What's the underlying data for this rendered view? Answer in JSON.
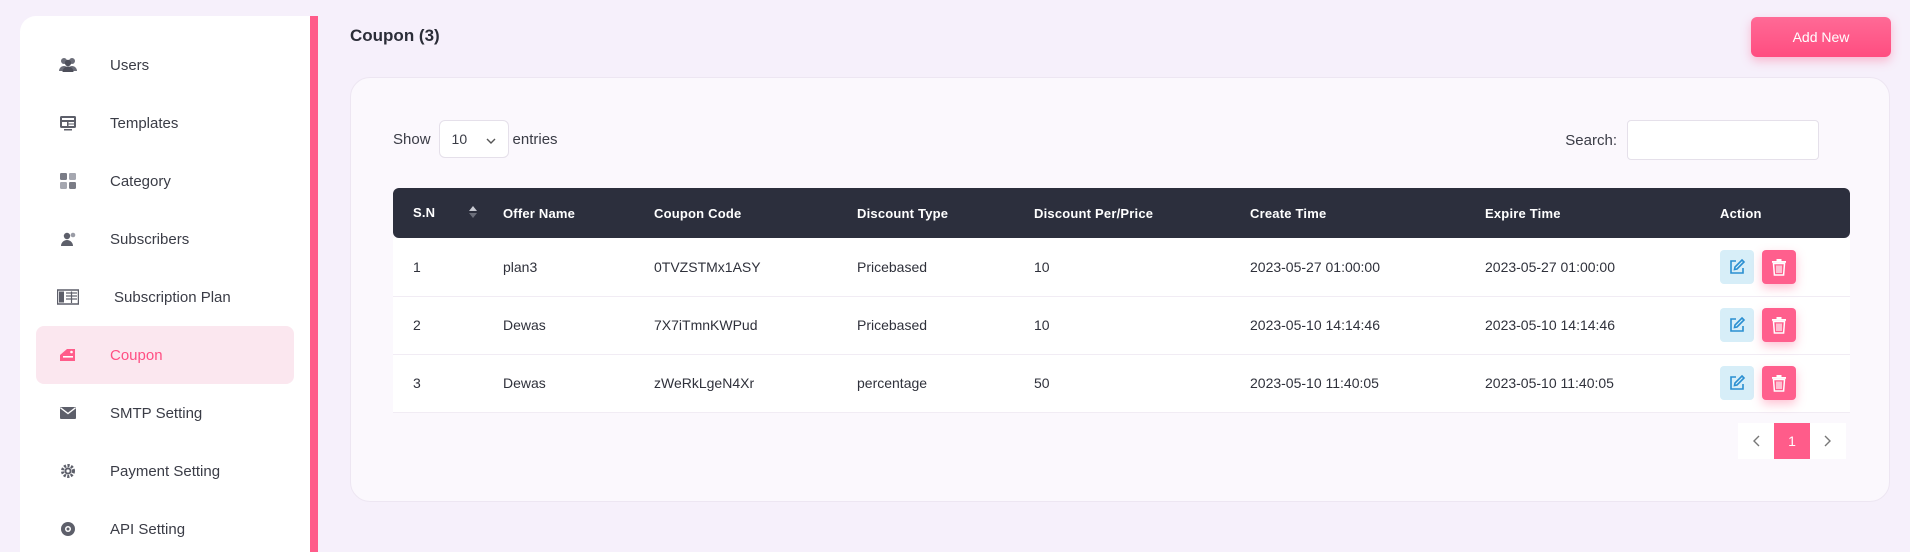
{
  "sidebar": {
    "items": [
      {
        "label": "Users",
        "icon": "users-icon",
        "active": false
      },
      {
        "label": "Templates",
        "icon": "templates-icon",
        "active": false
      },
      {
        "label": "Category",
        "icon": "grid-icon",
        "active": false
      },
      {
        "label": "Subscribers",
        "icon": "user-bell-icon",
        "active": false
      },
      {
        "label": "Subscription Plan",
        "icon": "plan-table-icon",
        "active": false
      },
      {
        "label": "Coupon",
        "icon": "coupon-icon",
        "active": true
      },
      {
        "label": "SMTP Setting",
        "icon": "mail-icon",
        "active": false
      },
      {
        "label": "Payment Setting",
        "icon": "gear-icon",
        "active": false
      },
      {
        "label": "API Setting",
        "icon": "api-icon",
        "active": false
      }
    ]
  },
  "header": {
    "title": "Coupon (3)",
    "add_label": "Add New"
  },
  "controls": {
    "show_label": "Show",
    "length_value": "10",
    "entries_label": "entries",
    "search_label": "Search:",
    "search_value": ""
  },
  "table": {
    "columns": [
      "S.N",
      "Offer Name",
      "Coupon Code",
      "Discount Type",
      "Discount Per/Price",
      "Create Time",
      "Expire Time",
      "Action"
    ],
    "rows": [
      [
        "1",
        "plan3",
        "0TVZSTMx1ASY",
        "Pricebased",
        "10",
        "2023-05-27 01:00:00",
        "2023-05-27 01:00:00"
      ],
      [
        "2",
        "Dewas",
        "7X7iTmnKWPud",
        "Pricebased",
        "10",
        "2023-05-10 14:14:46",
        "2023-05-10 14:14:46"
      ],
      [
        "3",
        "Dewas",
        "zWeRkLgeN4Xr",
        "percentage",
        "50",
        "2023-05-10 11:40:05",
        "2023-05-10 11:40:05"
      ]
    ]
  },
  "pagination": {
    "current": "1"
  },
  "colors": {
    "accent": "#ff5c8a",
    "header_bg": "#2c2f3d",
    "edit_bg": "#d7eef8",
    "edit_icon": "#2a8fd1"
  }
}
